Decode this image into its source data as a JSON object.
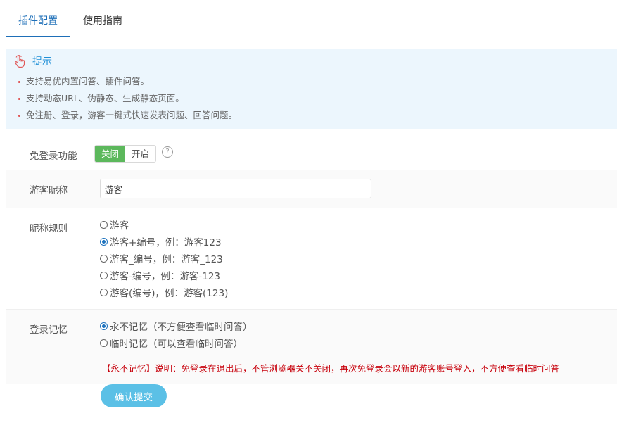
{
  "tabs": [
    {
      "label": "插件配置",
      "active": true
    },
    {
      "label": "使用指南",
      "active": false
    }
  ],
  "tip": {
    "icon": "hand-pointer-icon",
    "title": "提示",
    "items": [
      "支持易优内置问答、插件问答。",
      "支持动态URL、伪静态、生成静态页面。",
      "免注册、登录，游客一键式快速发表问题、回答问题。"
    ]
  },
  "form": {
    "free_login": {
      "label": "免登录功能",
      "options": [
        "关闭",
        "开启"
      ],
      "selected": "关闭",
      "help_icon": "question-circle-icon"
    },
    "nickname": {
      "label": "游客昵称",
      "value": "游客"
    },
    "nickname_rule": {
      "label": "昵称规则",
      "options": [
        "游客",
        "游客+编号，例：游客123",
        "游客_编号，例：游客_123",
        "游客-编号，例：游客-123",
        "游客(编号)，例：游客(123)"
      ],
      "selected": 1
    },
    "remember": {
      "label": "登录记忆",
      "options": [
        "永不记忆（不方便查看临时问答）",
        "临时记忆（可以查看临时问答）"
      ],
      "selected": 0,
      "note": "【永不记忆】说明：免登录在退出后，不管浏览器关不关闭，再次免登录会以新的游客账号登入，不方便查看临时问答"
    },
    "submit_label": "确认提交"
  },
  "colors": {
    "accent": "#1e6fb8",
    "switch_on": "#5cb85c",
    "button": "#5bc0e6",
    "warning": "#c7000b",
    "tip_bg": "#ecf6fd"
  }
}
